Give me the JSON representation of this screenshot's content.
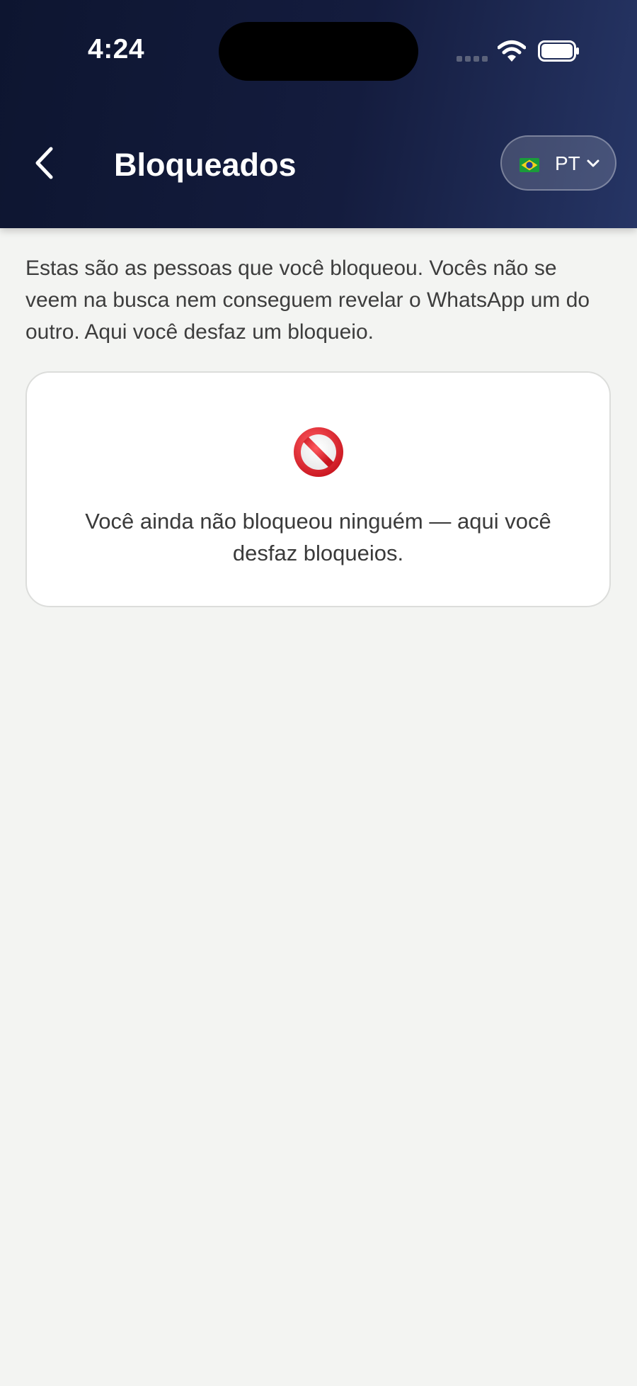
{
  "status_bar": {
    "time": "4:24"
  },
  "header": {
    "title": "Bloqueados",
    "back_icon": "chevron-left-icon",
    "language": {
      "flag": "brazil-flag-icon",
      "code": "PT",
      "dropdown_icon": "chevron-down-icon"
    }
  },
  "main": {
    "intro": "Estas são as pessoas que você bloqueou. Vocês não se veem na busca nem conseguem revelar o WhatsApp um do outro. Aqui você desfaz um bloqueio.",
    "empty_state": {
      "icon": "prohibited-icon",
      "message": "Você ainda não bloqueou ninguém — aqui você desfaz bloqueios."
    }
  },
  "colors": {
    "header_dark": "#0d1530",
    "header_light": "#263565",
    "background": "#f3f4f2",
    "card": "#ffffff",
    "prohibited_red": "#e0202b"
  }
}
